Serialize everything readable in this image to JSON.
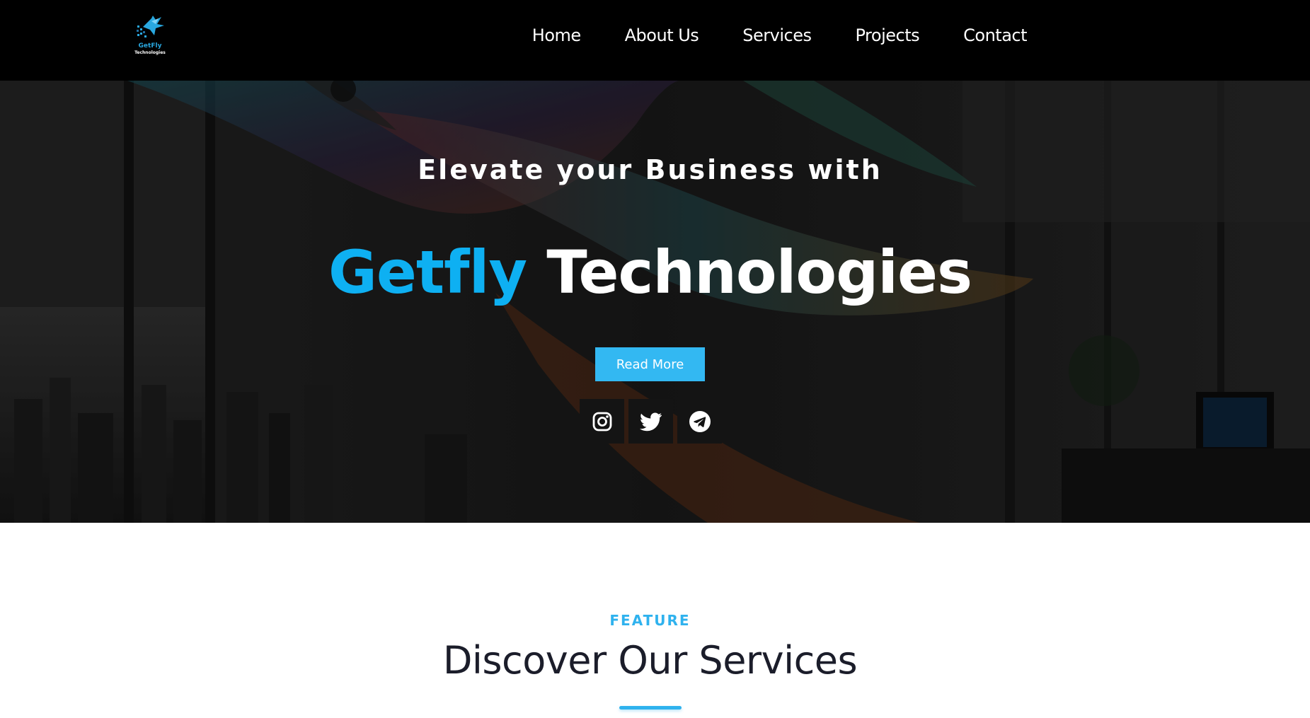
{
  "brand": {
    "logo_name": "GetFly",
    "logo_tagline": "Technologies"
  },
  "nav": {
    "items": [
      {
        "label": "Home"
      },
      {
        "label": "About Us"
      },
      {
        "label": "Services"
      },
      {
        "label": "Projects"
      },
      {
        "label": "Contact"
      }
    ]
  },
  "hero": {
    "subtitle": "Elevate your Business with",
    "title_accent": "Getfly",
    "title_main": "Technologies",
    "cta_label": "Read More",
    "socials": [
      "instagram-icon",
      "twitter-icon",
      "telegram-icon"
    ],
    "accent_color": "#0eb0f2",
    "button_color": "#33b8f2"
  },
  "feature": {
    "kicker": "FEATURE",
    "title": "Discover Our Services"
  }
}
